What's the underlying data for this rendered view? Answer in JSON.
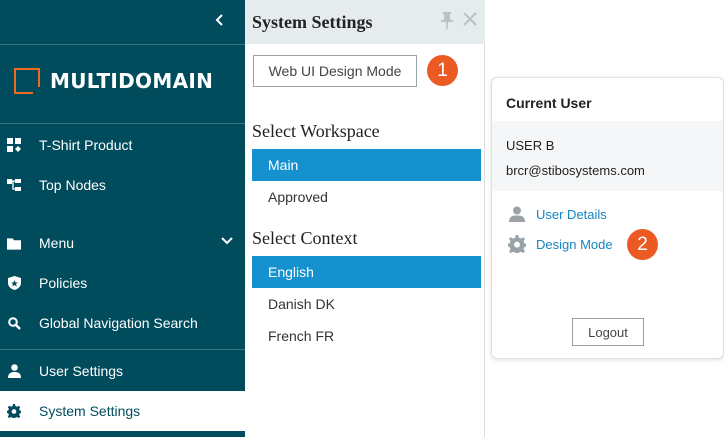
{
  "sidebar": {
    "logo_text": "MULTIDOMAIN",
    "items": [
      {
        "label": "T-Shirt Product",
        "icon": "product-icon"
      },
      {
        "label": "Top Nodes",
        "icon": "tree-icon"
      },
      {
        "label": "Menu",
        "icon": "folder-icon"
      },
      {
        "label": "Policies",
        "icon": "shield-icon"
      },
      {
        "label": "Global Navigation Search",
        "icon": "search-icon"
      },
      {
        "label": "User Settings",
        "icon": "user-icon"
      },
      {
        "label": "System Settings",
        "icon": "gear-icon"
      }
    ],
    "active_item": "System Settings"
  },
  "panel": {
    "title": "System Settings",
    "design_mode_button": "Web UI Design Mode",
    "callout_1": "1",
    "workspace_title": "Select Workspace",
    "workspaces": [
      "Main",
      "Approved"
    ],
    "selected_workspace": "Main",
    "context_title": "Select Context",
    "contexts": [
      "English",
      "Danish DK",
      "French FR"
    ],
    "selected_context": "English"
  },
  "user_card": {
    "title": "Current User",
    "username": "USER B",
    "email": "brcr@stibosystems.com",
    "user_details_link": "User Details",
    "design_mode_link": "Design Mode",
    "callout_2": "2",
    "logout_button": "Logout"
  },
  "colors": {
    "sidebar_bg": "#004c5d",
    "accent_orange": "#ec5a24",
    "selection_blue": "#1591cf",
    "link_blue": "#1585c3"
  }
}
